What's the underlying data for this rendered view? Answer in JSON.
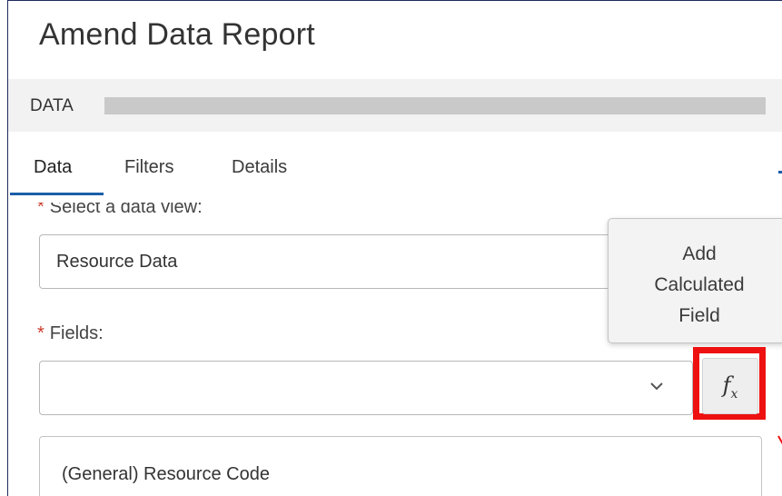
{
  "page": {
    "title": "Amend Data Report"
  },
  "data_section": {
    "label": "DATA"
  },
  "tabs": [
    {
      "label": "Data",
      "active": true
    },
    {
      "label": "Filters",
      "active": false
    },
    {
      "label": "Details",
      "active": false
    }
  ],
  "form": {
    "data_view": {
      "required_mark": "*",
      "label": "Select a data view:",
      "value": "Resource Data"
    },
    "fields": {
      "required_mark": "*",
      "label": "Fields:",
      "value": ""
    },
    "selected_fields": [
      "(General) Resource Code"
    ]
  },
  "tooltip": {
    "line1": "Add",
    "line2": "Calculated",
    "line3": "Field"
  },
  "fx_button": {
    "symbol": "f",
    "subscript": "x"
  },
  "colors": {
    "accent": "#1a5fa8",
    "highlight": "#ee1111",
    "required": "#cc3a2a"
  },
  "icons": {
    "chevron": "chevron-down-icon",
    "fx": "function-icon"
  }
}
